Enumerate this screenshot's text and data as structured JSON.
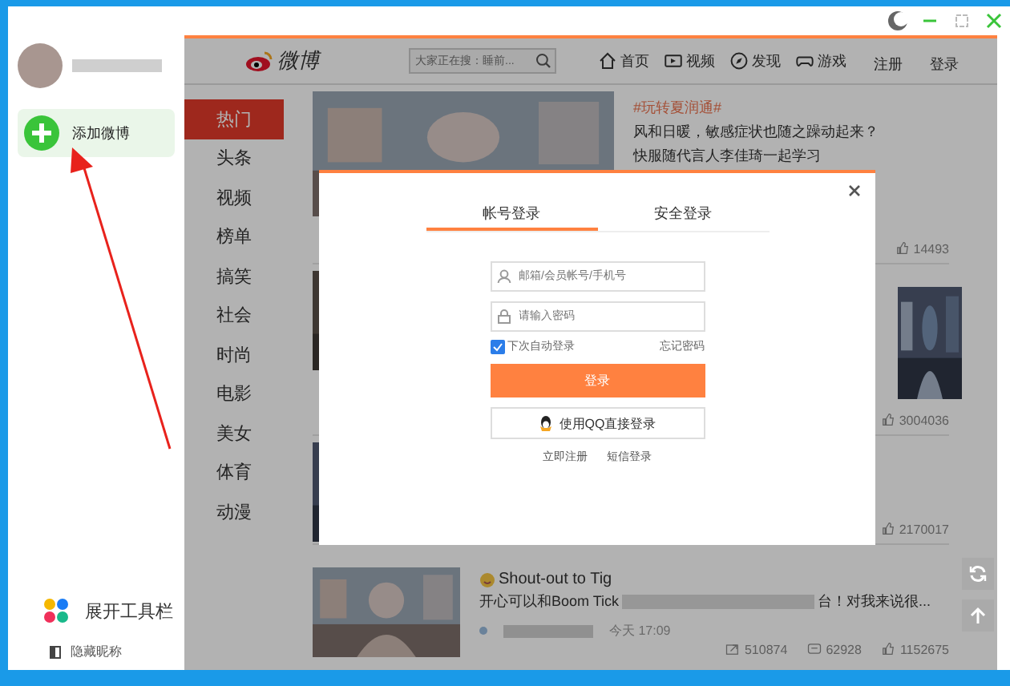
{
  "sidebar": {
    "add_button": {
      "label": "添加微博"
    },
    "toolbar_toggle": {
      "label": "展开工具栏"
    },
    "hide_nickname": {
      "label": "隐藏昵称"
    }
  },
  "header": {
    "logo": "微博",
    "search": {
      "placeholder": "大家正在搜：睡前..."
    },
    "nav": [
      {
        "label": "首页",
        "kind": "home"
      },
      {
        "label": "视频",
        "kind": "video"
      },
      {
        "label": "发现",
        "kind": "discover"
      },
      {
        "label": "游戏",
        "kind": "game"
      },
      {
        "label": "注册",
        "kind": "text"
      },
      {
        "label": "登录",
        "kind": "text"
      }
    ]
  },
  "categories": [
    {
      "label": "热门",
      "selected": true
    },
    {
      "label": "头条",
      "selected": false
    },
    {
      "label": "视频",
      "selected": false
    },
    {
      "label": "榜单",
      "selected": false
    },
    {
      "label": "搞笑",
      "selected": false
    },
    {
      "label": "社会",
      "selected": false
    },
    {
      "label": "时尚",
      "selected": false
    },
    {
      "label": "电影",
      "selected": false
    },
    {
      "label": "美女",
      "selected": false
    },
    {
      "label": "体育",
      "selected": false
    },
    {
      "label": "动漫",
      "selected": false
    }
  ],
  "feed": [
    {
      "tag": "#玩转夏润通#",
      "lines": [
        "风和日暖，敏感症状也随之躁动起来？",
        "快服随代言人李佳琦一起学习"
      ],
      "stats": [
        {
          "kind": "like",
          "value": "14493"
        }
      ]
    },
    {
      "stats": [
        {
          "kind": "like",
          "value": "3004036"
        }
      ]
    },
    {
      "stats": [
        {
          "kind": "like",
          "value": "2170017"
        }
      ]
    },
    {
      "title": "Shout-out to Tig",
      "body": "开心可以和Boom Tick",
      "body_tail": "台！对我来说很...",
      "time": "今天 17:09",
      "stats": [
        {
          "kind": "share",
          "value": "510874"
        },
        {
          "kind": "comment",
          "value": "62928"
        },
        {
          "kind": "like",
          "value": "1152675"
        }
      ]
    }
  ],
  "login_dialog": {
    "tabs": [
      {
        "label": "帐号登录",
        "selected": true
      },
      {
        "label": "安全登录",
        "selected": false
      }
    ],
    "username": {
      "placeholder": "邮箱/会员帐号/手机号"
    },
    "password": {
      "placeholder": "请输入密码"
    },
    "remember": {
      "label": "下次自动登录",
      "checked": true
    },
    "forgot": "忘记密码",
    "submit": "登录",
    "qq_login": "使用QQ直接登录",
    "links": [
      "立即注册",
      "短信登录"
    ]
  }
}
